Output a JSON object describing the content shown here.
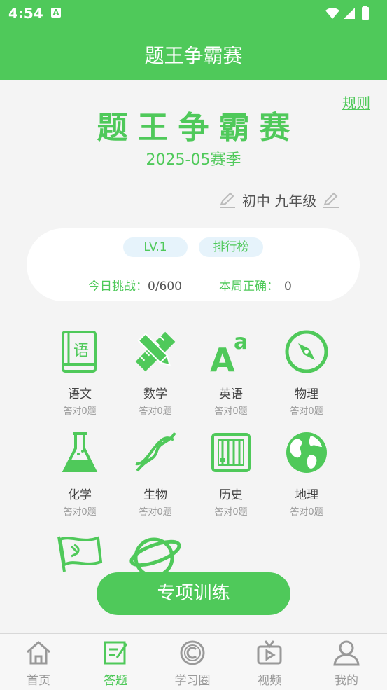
{
  "status": {
    "time": "4:54",
    "notif": "A"
  },
  "appbar": {
    "title": "题王争霸赛"
  },
  "header": {
    "rules": "规则",
    "title": "题王争霸赛",
    "season": "2025-05赛季",
    "grade": "初中 九年级"
  },
  "card": {
    "level": "LV.1",
    "ranking": "排行榜",
    "today_label": "今日挑战：",
    "today_value": "0/600",
    "week_label": "本周正确：",
    "week_value": "0"
  },
  "subjects": [
    {
      "name": "语文",
      "count": "答对0题",
      "icon": "chinese-book-icon"
    },
    {
      "name": "数学",
      "count": "答对0题",
      "icon": "pencil-ruler-icon"
    },
    {
      "name": "英语",
      "count": "答对0题",
      "icon": "letters-icon"
    },
    {
      "name": "物理",
      "count": "答对0题",
      "icon": "compass-icon"
    },
    {
      "name": "化学",
      "count": "答对0题",
      "icon": "flask-icon"
    },
    {
      "name": "生物",
      "count": "答对0题",
      "icon": "dna-icon"
    },
    {
      "name": "历史",
      "count": "答对0题",
      "icon": "abacus-icon"
    },
    {
      "name": "地理",
      "count": "答对0题",
      "icon": "globe-icon"
    }
  ],
  "train_button": "专项训练",
  "tabs": [
    {
      "label": "首页",
      "icon": "home-icon"
    },
    {
      "label": "答题",
      "icon": "answer-icon"
    },
    {
      "label": "学习圈",
      "icon": "circle-c-icon"
    },
    {
      "label": "视频",
      "icon": "tv-icon"
    },
    {
      "label": "我的",
      "icon": "person-icon"
    }
  ],
  "colors": {
    "accent": "#4fc95a",
    "pill": "#e6f3fb"
  }
}
